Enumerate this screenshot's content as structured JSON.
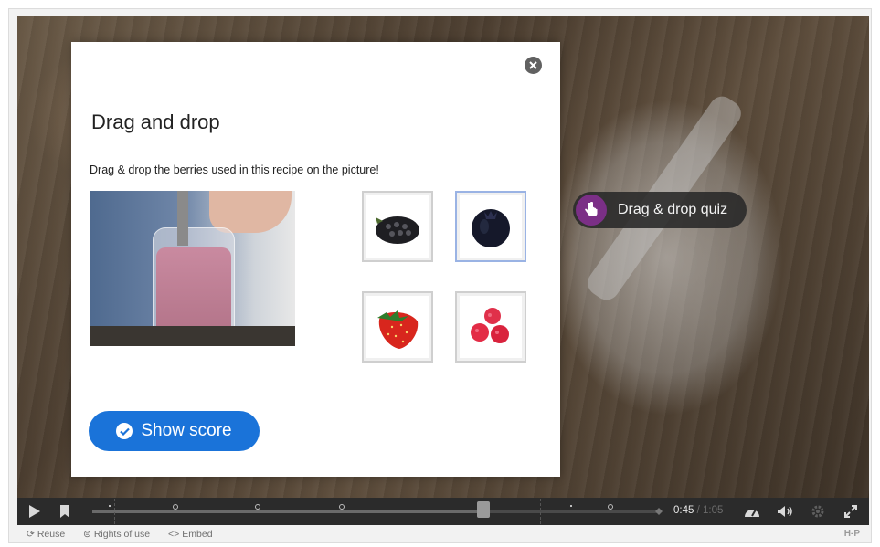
{
  "hotspot": {
    "label": "Drag & drop quiz",
    "badge_color": "#7b2f86"
  },
  "dialog": {
    "title": "Drag and drop",
    "task": "Drag & drop the berries used in this recipe on the picture!",
    "items": [
      {
        "name": "blackberry",
        "icon": "blackberry-icon"
      },
      {
        "name": "blueberry",
        "icon": "blueberry-icon",
        "selected": true
      },
      {
        "name": "strawberry",
        "icon": "strawberry-icon"
      },
      {
        "name": "raspberry",
        "icon": "raspberry-icon"
      }
    ],
    "show_score_label": "Show score"
  },
  "player": {
    "current_time": "0:45",
    "separator": " / ",
    "total_time": "1:05",
    "progress": 0.69
  },
  "footer": {
    "reuse": "Reuse",
    "rights": "Rights of use",
    "embed": "Embed",
    "brand": "H-P"
  },
  "colors": {
    "accent": "#1a73d9",
    "control_bar": "#2b2b2b"
  }
}
